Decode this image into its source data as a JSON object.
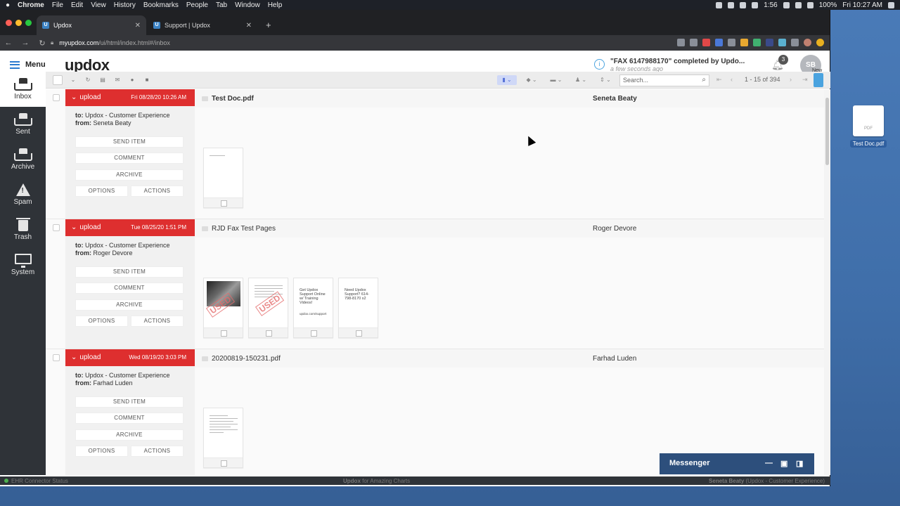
{
  "mac_menu": {
    "items": [
      "Chrome",
      "File",
      "Edit",
      "View",
      "History",
      "Bookmarks",
      "People",
      "Tab",
      "Window",
      "Help"
    ],
    "battery": "100%",
    "clock": "Fri 10:27 AM",
    "timer": "1:56"
  },
  "browser": {
    "tabs": [
      {
        "label": "Updox",
        "favicon": "U"
      },
      {
        "label": "Support | Updox",
        "favicon": "U"
      }
    ],
    "url_host": "myupdox.com",
    "url_path": "/ui/html/index.html#/inbox"
  },
  "header": {
    "menu_label": "Menu",
    "logo": "updox",
    "notification_title": "\"FAX 6147988170\" completed by Updo...",
    "notification_time": "a few seconds ago",
    "bell_count": "3",
    "avatar_initials": "SB"
  },
  "sidebar": {
    "items": [
      {
        "label": "Inbox",
        "icon": "inbox-icon"
      },
      {
        "label": "Sent",
        "icon": "sent-icon"
      },
      {
        "label": "Archive",
        "icon": "archive-icon"
      },
      {
        "label": "Spam",
        "icon": "spam-icon"
      },
      {
        "label": "Trash",
        "icon": "trash-icon"
      },
      {
        "label": "System",
        "icon": "system-icon"
      }
    ]
  },
  "toolbar": {
    "search_placeholder": "Search...",
    "pagination": "1 - 15 of 394",
    "new_label": "New"
  },
  "actions": {
    "send": "SEND ITEM",
    "comment": "COMMENT",
    "archive": "ARCHIVE",
    "options": "OPTIONS",
    "actions": "ACTIONS"
  },
  "labels": {
    "to": "to:",
    "from": "from:"
  },
  "items": [
    {
      "type": "upload",
      "date": "Fri 08/28/20 10:26 AM",
      "to": "Updox - Customer Experience",
      "from": "Seneta Beaty",
      "subject": "Test Doc.pdf",
      "sender": "Seneta Beaty"
    },
    {
      "type": "upload",
      "date": "Tue 08/25/20 1:51 PM",
      "to": "Updox - Customer Experience",
      "from": "Roger Devore",
      "subject": "RJD Fax Test Pages",
      "sender": "Roger Devore",
      "thumb_texts": [
        "Get Updox Support Online w/ Training Videos!",
        "Need Updox Support? 614-798-8170 x2"
      ],
      "used_stamp": "USED",
      "support_url": "updox.com/support"
    },
    {
      "type": "upload",
      "date": "Wed 08/19/20 3:03 PM",
      "to": "Updox - Customer Experience",
      "from": "Farhad Luden",
      "subject": "20200819-150231.pdf",
      "sender": "Farhad Luden"
    }
  ],
  "statusbar": {
    "left": "EHR Connector Status",
    "center_brand": "Updox",
    "center_rest": "for Amazing Charts",
    "right_user": "Seneta Beaty",
    "right_org": "(Updox - Customer Experience)"
  },
  "messenger": {
    "label": "Messenger"
  },
  "desktop": {
    "file_name": "Test Doc.pdf",
    "file_type": "PDF"
  }
}
